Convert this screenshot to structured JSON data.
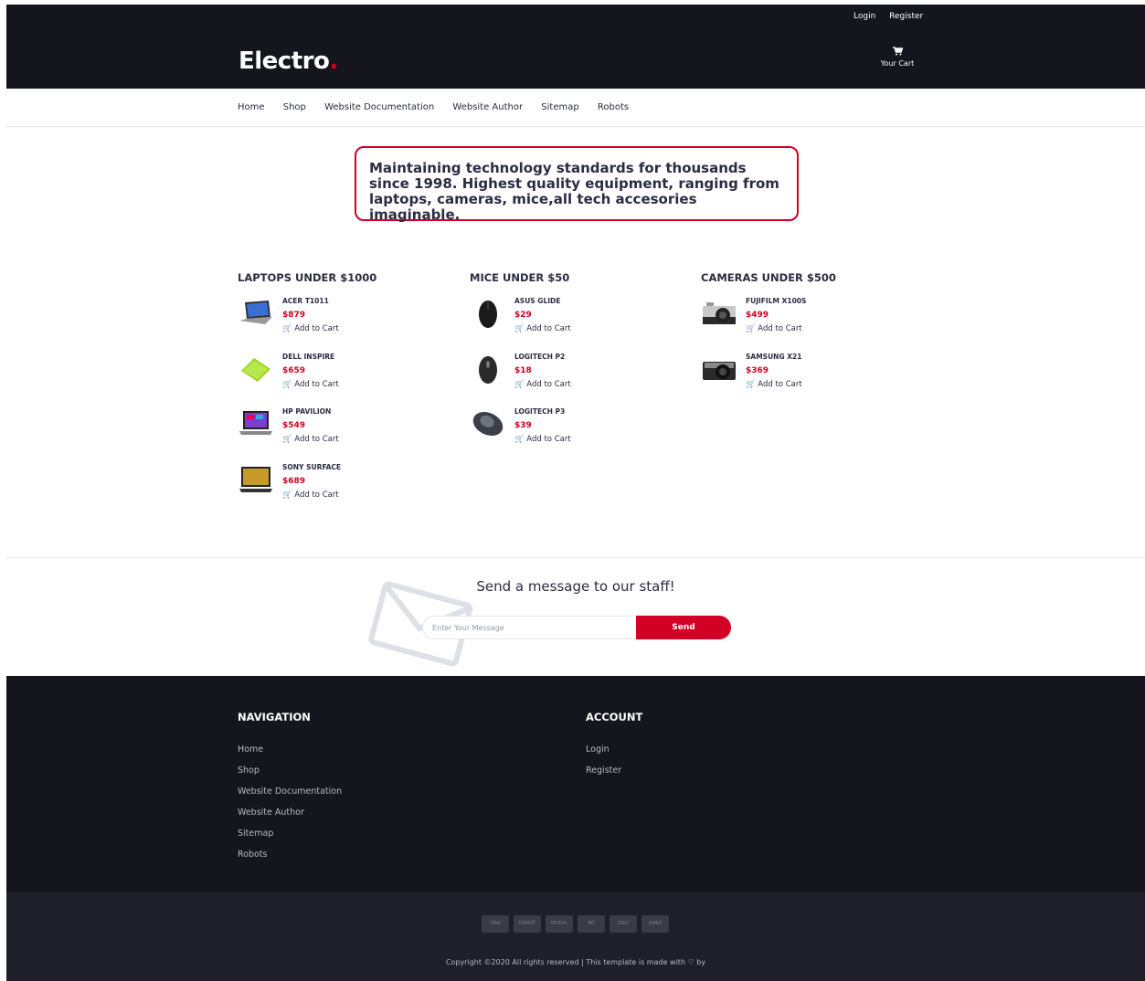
{
  "header": {
    "top_links": [
      "Login",
      "Register"
    ],
    "logo_text": "Electro",
    "logo_dot": ".",
    "cart_label": "Your Cart",
    "cart_icon": "cart-icon"
  },
  "nav": {
    "items": [
      "Home",
      "Shop",
      "Website Documentation",
      "Website Author",
      "Sitemap",
      "Robots"
    ]
  },
  "tagline": "Maintaining technology standards for thousands since 1998. Highest quality equipment, ranging from laptops, cameras, mice,all tech accesories imaginable.",
  "columns": [
    {
      "title": "LAPTOPS UNDER $1000",
      "products": [
        {
          "name": "ACER T1011",
          "price": "$879",
          "add": "Add to Cart",
          "icon": "laptop"
        },
        {
          "name": "DELL INSPIRE",
          "price": "$659",
          "add": "Add to Cart",
          "icon": "laptop"
        },
        {
          "name": "HP PAVILION",
          "price": "$549",
          "add": "Add to Cart",
          "icon": "laptop"
        },
        {
          "name": "SONY SURFACE",
          "price": "$689",
          "add": "Add to Cart",
          "icon": "laptop"
        }
      ]
    },
    {
      "title": "MICE UNDER $50",
      "products": [
        {
          "name": "ASUS GLIDE",
          "price": "$29",
          "add": "Add to Cart",
          "icon": "mouse"
        },
        {
          "name": "LOGITECH P2",
          "price": "$18",
          "add": "Add to Cart",
          "icon": "mouse"
        },
        {
          "name": "LOGITECH P3",
          "price": "$39",
          "add": "Add to Cart",
          "icon": "mouse"
        }
      ]
    },
    {
      "title": "CAMERAS UNDER $500",
      "products": [
        {
          "name": "FUJIFILM X100S",
          "price": "$499",
          "add": "Add to Cart",
          "icon": "camera"
        },
        {
          "name": "SAMSUNG X21",
          "price": "$369",
          "add": "Add to Cart",
          "icon": "camera"
        }
      ]
    }
  ],
  "newsletter": {
    "title": "Send a message to our staff!",
    "placeholder": "Enter Your Message",
    "button": "Send"
  },
  "footer": {
    "navigation": {
      "title": "NAVIGATION",
      "links": [
        "Home",
        "Shop",
        "Website Documentation",
        "Website Author",
        "Sitemap",
        "Robots"
      ]
    },
    "account": {
      "title": "ACCOUNT",
      "links": [
        "Login",
        "Register"
      ]
    },
    "payment_cards": [
      "VISA",
      "CREDIT",
      "PAYPAL",
      "MC",
      "DISC",
      "AMEX"
    ],
    "copyright": "Copyright ©2020 All rights reserved | This template is made with ♡ by"
  },
  "colors": {
    "accent": "#d10024",
    "header_bg": "#15161d",
    "bottom_footer_bg": "#1e1f29",
    "text_dark": "#2b2d42"
  }
}
